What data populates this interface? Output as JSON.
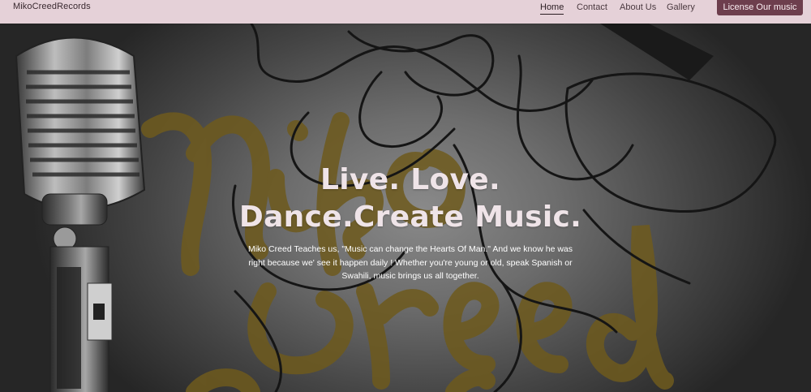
{
  "nav": {
    "brand": "MikoCreedRecords",
    "links": [
      "Home",
      "Contact",
      "About Us",
      "Gallery"
    ],
    "active": "Home",
    "cta_label": "License Our music"
  },
  "hero": {
    "title_line1": "Live. Love.",
    "title_line2": "Dance.Create Music.",
    "body": "Miko Creed Teaches us, \"Music can change the Hearts Of Man.\" And we know he was right because we' see it happen daily ! Whether you're young or old, speak Spanish or Swahili, music brings us all together.",
    "background_art": [
      "microphone-image",
      "script-logo-watermark",
      "line-art-dancer"
    ]
  },
  "colors": {
    "nav_bg": "#e5d1d8",
    "cta_bg": "#6d3e4d",
    "title": "#efe4e8",
    "watermark": "#6e5a1d"
  }
}
